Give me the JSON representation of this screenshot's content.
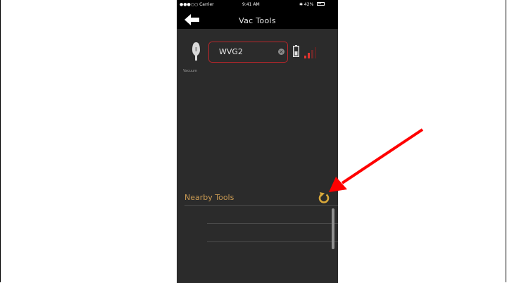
{
  "status_bar": {
    "carrier": "●●●○○ Carrier ",
    "time": "9:41 AM",
    "battery": "✱ 42%"
  },
  "nav": {
    "title": "Vac Tools"
  },
  "tool": {
    "icon_label": "Vacuum",
    "value": "WVG2"
  },
  "nearby": {
    "label": "Nearby Tools"
  },
  "colors": {
    "accent": "#c99a53",
    "field_border": "#b8262b",
    "signal": "#e3342f",
    "background": "#2b2b2b",
    "annotation_arrow": "#ff0000"
  },
  "icons": {
    "back": "back-arrow-icon",
    "vacuum": "vacuum-cup-icon",
    "clear": "clear-icon",
    "battery": "battery-icon",
    "signal": "signal-icon",
    "refresh": "refresh-icon"
  }
}
